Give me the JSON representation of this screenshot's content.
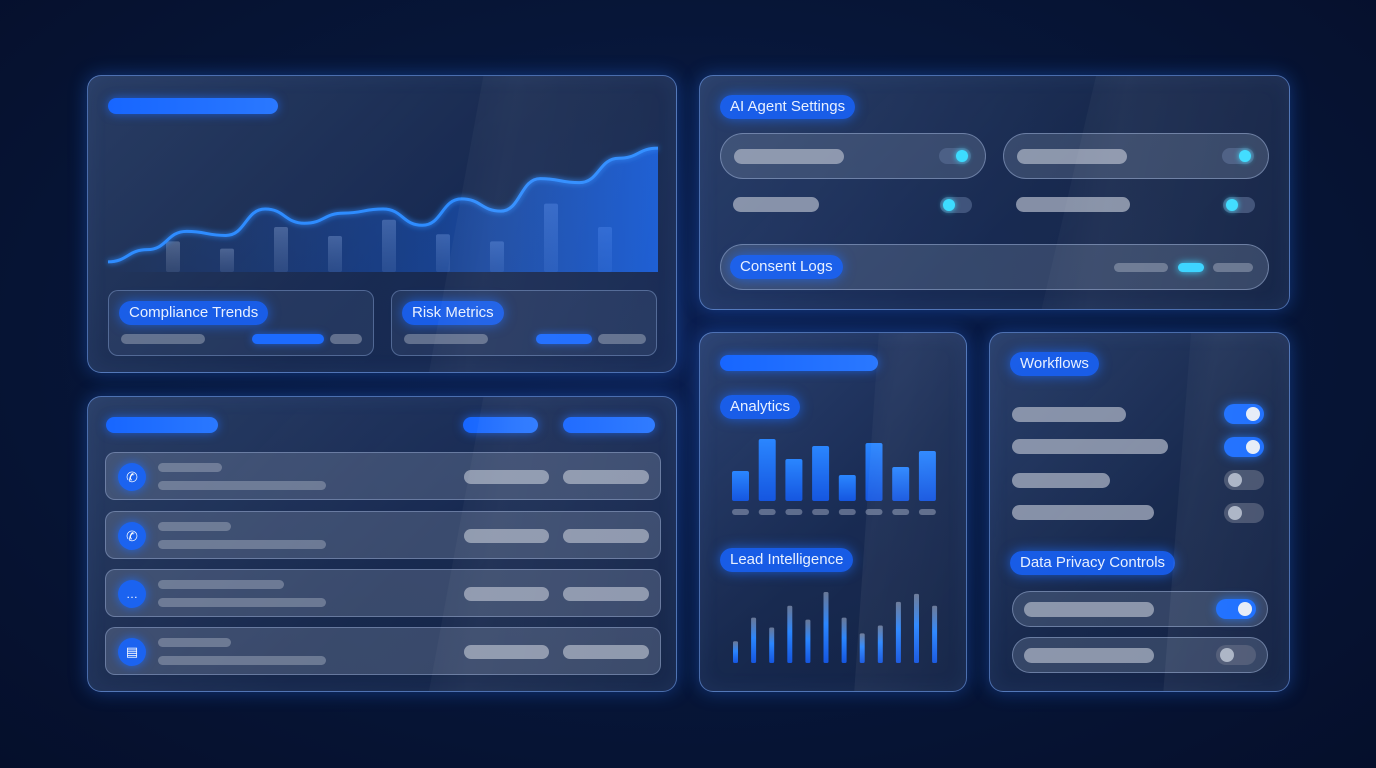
{
  "compliance_panel": {
    "card_labels": [
      "Compliance Trends",
      "Risk Metrics"
    ],
    "chart_data": {
      "type": "area",
      "trend": [
        10,
        22,
        40,
        36,
        62,
        48,
        58,
        62,
        46,
        72,
        60,
        92,
        88,
        112,
        122
      ],
      "bars": [
        34,
        26,
        50,
        40,
        58,
        42,
        34,
        76,
        50
      ]
    }
  },
  "agent_settings": {
    "title": "AI Agent Settings",
    "consent_label": "Consent Logs"
  },
  "analytics": {
    "label": "Analytics",
    "chart_data": {
      "type": "bar",
      "values": [
        30,
        62,
        42,
        55,
        26,
        58,
        34,
        50
      ]
    }
  },
  "lead_intelligence": {
    "label": "Lead Intelligence",
    "chart_data": {
      "type": "bar",
      "values": [
        22,
        46,
        36,
        58,
        44,
        72,
        46,
        30,
        38,
        62,
        70,
        58
      ]
    }
  },
  "workflows": {
    "label": "Workflows",
    "toggles": [
      true,
      true,
      false,
      false
    ]
  },
  "privacy": {
    "label": "Data Privacy Controls",
    "toggles": [
      true,
      false
    ]
  },
  "contact_list": {
    "rows": [
      {
        "icon": "phone-icon"
      },
      {
        "icon": "phone-call-icon"
      },
      {
        "icon": "chat-icon"
      },
      {
        "icon": "document-icon"
      }
    ]
  },
  "colors": {
    "accent": "#1a6dff",
    "cyan": "#39d7ff",
    "background": "#071638"
  }
}
